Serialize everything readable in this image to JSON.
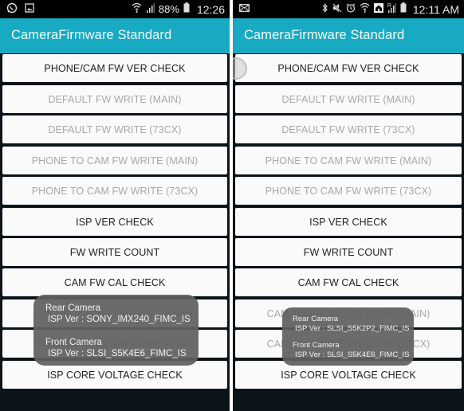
{
  "screens": [
    {
      "status_bar": {
        "left_icons": [
          "whatsapp-icon",
          "gallery-icon"
        ],
        "right_icons": [
          "wifi-icon",
          "signal-icon"
        ],
        "battery_percent": "88%",
        "time": "12:26"
      },
      "app_title": "CameraFirmware Standard",
      "buttons": [
        {
          "label": "PHONE/CAM FW VER CHECK",
          "enabled": true
        },
        {
          "label": "DEFAULT FW WRITE (MAIN)",
          "enabled": false
        },
        {
          "label": "DEFAULT FW WRITE (73CX)",
          "enabled": false
        },
        {
          "label": "PHONE TO CAM FW WRITE (MAIN)",
          "enabled": false
        },
        {
          "label": "PHONE TO CAM FW WRITE (73CX)",
          "enabled": false
        },
        {
          "label": "ISP VER CHECK",
          "enabled": true
        },
        {
          "label": "FW WRITE COUNT",
          "enabled": true
        },
        {
          "label": "CAM FW CAL CHECK",
          "enabled": true
        },
        {
          "label": "CAM TO PHONE FW DUMP (MAIN)",
          "enabled": false
        },
        {
          "label": "CAM TO PHONE FW DUMP (73CX)",
          "enabled": false
        },
        {
          "label": "ISP CORE VOLTAGE CHECK",
          "enabled": true
        }
      ],
      "toast": {
        "rear_title": "Rear Camera",
        "rear_value": "ISP Ver : SONY_IMX240_FIMC_IS",
        "front_title": "Front Camera",
        "front_value": "ISP Ver : SLSI_S5K4E6_FIMC_IS"
      }
    },
    {
      "status_bar": {
        "left_icons": [
          "email-icon"
        ],
        "right_icons": [
          "bluetooth-icon",
          "mute-icon",
          "alarm-icon",
          "wifi-icon",
          "home-icon",
          "roaming-signal-icon",
          "battery-icon"
        ],
        "roaming_label": "R",
        "time": "12:11 AM"
      },
      "app_title": "CameraFirmware Standard",
      "touch_indicator": "7",
      "buttons": [
        {
          "label": "PHONE/CAM FW VER CHECK",
          "enabled": true
        },
        {
          "label": "DEFAULT FW WRITE (MAIN)",
          "enabled": false
        },
        {
          "label": "DEFAULT FW WRITE (73CX)",
          "enabled": false
        },
        {
          "label": "PHONE TO CAM FW WRITE (MAIN)",
          "enabled": false
        },
        {
          "label": "PHONE TO CAM FW WRITE (73CX)",
          "enabled": false
        },
        {
          "label": "ISP VER CHECK",
          "enabled": true
        },
        {
          "label": "FW WRITE COUNT",
          "enabled": true
        },
        {
          "label": "CAM FW CAL CHECK",
          "enabled": true
        },
        {
          "label": "CAM TO PHONE FW DUMP (MAIN)",
          "enabled": false
        },
        {
          "label": "CAM TO PHONE FW DUMP (73CX)",
          "enabled": false
        },
        {
          "label": "ISP CORE VOLTAGE CHECK",
          "enabled": true
        }
      ],
      "toast": {
        "rear_title": "Rear Camera",
        "rear_value": "ISP Ver : SLSI_S5K2P2_FIMC_IS",
        "front_title": "Front Camera",
        "front_value": "ISP Ver : SLSI_S5K4E6_FIMC_IS"
      }
    }
  ],
  "colors": {
    "app_bar": "#19aac3",
    "status_bar": "#000000",
    "button_bg": "#fafafa",
    "button_text_enabled": "#1d1d1d",
    "button_text_disabled": "#a8a8a8",
    "toast_bg": "#606060"
  }
}
